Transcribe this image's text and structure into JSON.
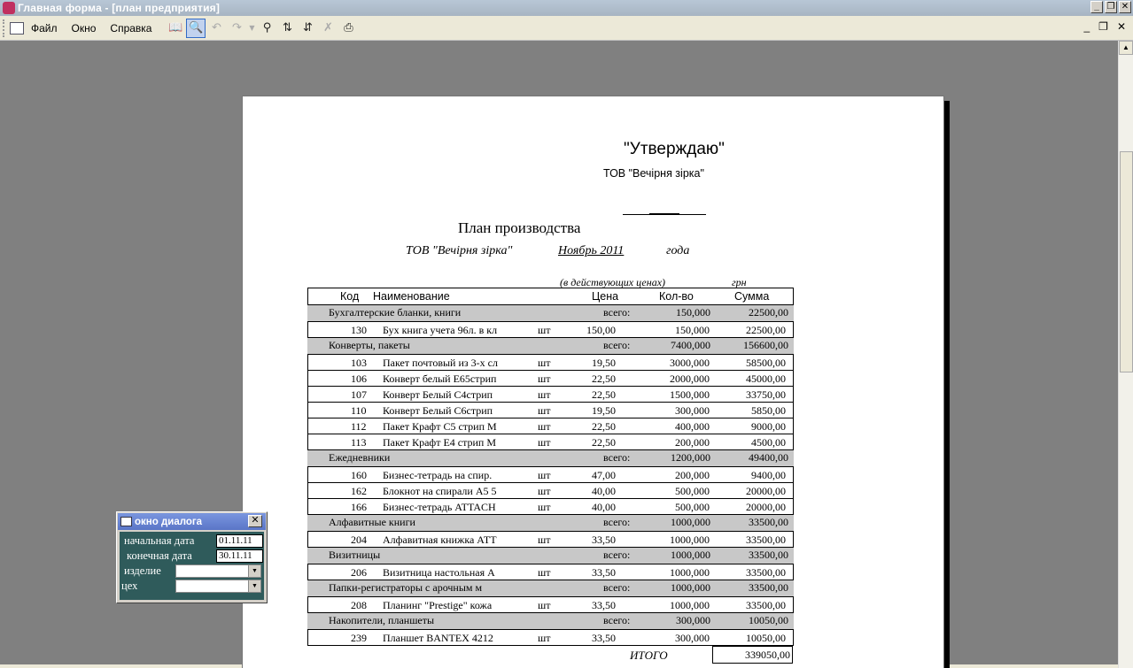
{
  "window": {
    "title": "Главная форма - [план предприятия]"
  },
  "menu": {
    "items": [
      "Файл",
      "Окно",
      "Справка"
    ]
  },
  "toolbar": {
    "icons": [
      "book-icon",
      "preview-icon",
      "undo-icon",
      "redo-icon",
      "find-icon",
      "sort-asc-icon",
      "sort-desc-icon",
      "delete-icon",
      "print-icon"
    ]
  },
  "report": {
    "approve": "\"Утверждаю\"",
    "company": "ТОВ \"Вечірня зірка\"",
    "title": "План производства",
    "company_italic": "ТОВ \"Вечірня зірка\"",
    "period": "Ноябрь  2011",
    "year_word": "года",
    "price_note": "(в действующих ценах)",
    "currency": "грн",
    "headers": {
      "code": "Код",
      "name": "Наименование",
      "price": "Цена",
      "qty": "Кол-во",
      "sum": "Сумма"
    },
    "groups": [
      {
        "name": "Бухгалтерские бланки, книги",
        "total_label": "всего:",
        "qty": "150,000",
        "sum": "22500,00",
        "rows": [
          {
            "code": "130",
            "name": "Бух книга учета 96л. в кл",
            "unit": "шт",
            "price": "150,00",
            "qty": "150,000",
            "sum": "22500,00"
          }
        ]
      },
      {
        "name": "Конверты, пакеты",
        "total_label": "всего:",
        "qty": "7400,000",
        "sum": "156600,00",
        "rows": [
          {
            "code": "103",
            "name": "Пакет почтовый из 3-х сл",
            "unit": "шт",
            "price": "19,50",
            "qty": "3000,000",
            "sum": "58500,00"
          },
          {
            "code": "106",
            "name": "Конверт белый Е65стрип",
            "unit": "шт",
            "price": "22,50",
            "qty": "2000,000",
            "sum": "45000,00"
          },
          {
            "code": "107",
            "name": "Конверт Белый С4стрип",
            "unit": "шт",
            "price": "22,50",
            "qty": "1500,000",
            "sum": "33750,00"
          },
          {
            "code": "110",
            "name": "Конверт Белый С6стрип",
            "unit": "шт",
            "price": "19,50",
            "qty": "300,000",
            "sum": "5850,00"
          },
          {
            "code": "112",
            "name": "Пакет Крафт С5 стрип М",
            "unit": "шт",
            "price": "22,50",
            "qty": "400,000",
            "sum": "9000,00"
          },
          {
            "code": "113",
            "name": "Пакет Крафт Е4 стрип М",
            "unit": "шт",
            "price": "22,50",
            "qty": "200,000",
            "sum": "4500,00"
          }
        ]
      },
      {
        "name": "Ежедневники",
        "total_label": "всего:",
        "qty": "1200,000",
        "sum": "49400,00",
        "rows": [
          {
            "code": "160",
            "name": "Бизнес-тетрадь на спир.",
            "unit": "шт",
            "price": "47,00",
            "qty": "200,000",
            "sum": "9400,00"
          },
          {
            "code": "162",
            "name": "Блокнот на спирали А5 5",
            "unit": "шт",
            "price": "40,00",
            "qty": "500,000",
            "sum": "20000,00"
          },
          {
            "code": "166",
            "name": "Бизнес-тетрадь ATTACH",
            "unit": "шт",
            "price": "40,00",
            "qty": "500,000",
            "sum": "20000,00"
          }
        ]
      },
      {
        "name": "Алфавитные книги",
        "total_label": "всего:",
        "qty": "1000,000",
        "sum": "33500,00",
        "rows": [
          {
            "code": "204",
            "name": "Алфавитная книжка АТТ",
            "unit": "шт",
            "price": "33,50",
            "qty": "1000,000",
            "sum": "33500,00"
          }
        ]
      },
      {
        "name": "Визитницы",
        "total_label": "всего:",
        "qty": "1000,000",
        "sum": "33500,00",
        "rows": [
          {
            "code": "206",
            "name": "Визитница настольная А",
            "unit": "шт",
            "price": "33,50",
            "qty": "1000,000",
            "sum": "33500,00"
          }
        ]
      },
      {
        "name": "Папки-регистраторы с арочным м",
        "total_label": "всего:",
        "qty": "1000,000",
        "sum": "33500,00",
        "rows": [
          {
            "code": "208",
            "name": "Планинг \"Prestige\" кожа",
            "unit": "шт",
            "price": "33,50",
            "qty": "1000,000",
            "sum": "33500,00"
          }
        ]
      },
      {
        "name": "Накопители, планшеты",
        "total_label": "всего:",
        "qty": "300,000",
        "sum": "10050,00",
        "rows": [
          {
            "code": "239",
            "name": "Планшет BANTEX 4212",
            "unit": "шт",
            "price": "33,50",
            "qty": "300,000",
            "sum": "10050,00"
          }
        ]
      }
    ],
    "total_label": "ИТОГО",
    "total_sum": "339050,00"
  },
  "dialog": {
    "title": "окно диалога",
    "start_label": "начальная дата",
    "start_value": "01.11.11",
    "end_label": "конечная дата",
    "end_value": "30.11.11",
    "product_label": "изделие",
    "workshop_label": "цех"
  },
  "colors": {
    "titlebar": "#a7b4c2",
    "dialog_body": "#2f5b5b",
    "group_band": "#c8c8c8",
    "workspace": "#808080"
  }
}
